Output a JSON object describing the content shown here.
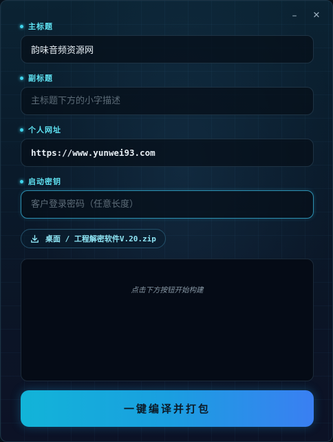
{
  "window": {
    "minimize_glyph": "–",
    "close_glyph": "✕"
  },
  "form": {
    "main_title": {
      "label": "主标题",
      "value": "韵味音频资源网",
      "placeholder": ""
    },
    "subtitle": {
      "label": "副标题",
      "value": "",
      "placeholder": "主标题下方的小字描述"
    },
    "website": {
      "label": "个人网址",
      "value": "https://www.yunwei93.com",
      "placeholder": ""
    },
    "startup_key": {
      "label": "启动密钥",
      "value": "",
      "placeholder": "客户登录密码（任意长度）"
    }
  },
  "output_file": {
    "path": "桌面 / 工程解密软件V.20.zip",
    "icon": "download-icon"
  },
  "log": {
    "hint": "点击下方按钮开始构建"
  },
  "build_button": {
    "label": "一键编译并打包"
  },
  "colors": {
    "accent": "#3fd4ec",
    "label": "#5ee0f0",
    "button_start": "#12b4d8",
    "button_end": "#3a7ff2"
  }
}
